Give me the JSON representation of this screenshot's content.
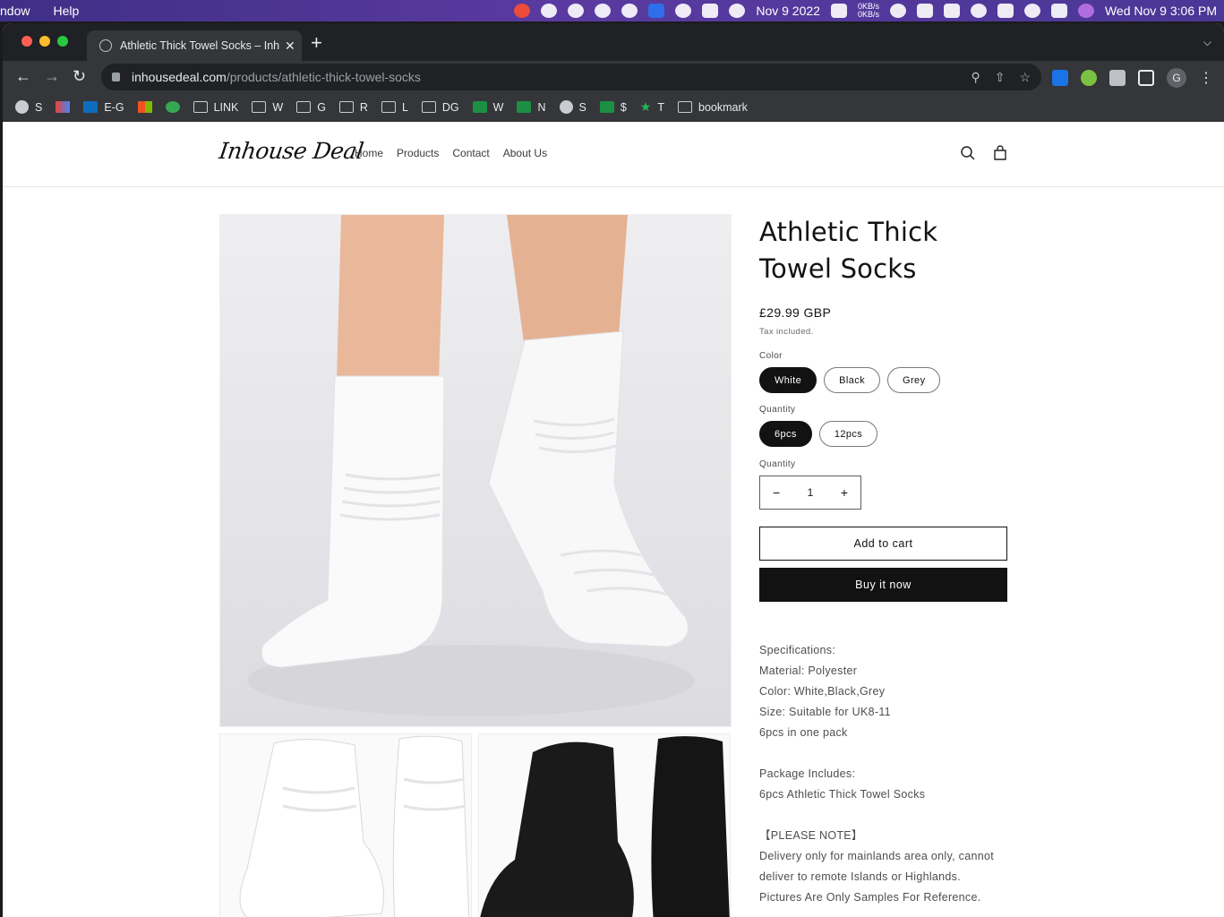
{
  "menubar": {
    "app_partial": "ndow",
    "help": "Help",
    "date": "Nov 9 2022",
    "net_up": "0KB/s",
    "net_down": "0KB/s",
    "clock": "Wed Nov 9  3:06 PM"
  },
  "browser": {
    "tab_title": "Athletic Thick Towel Socks – Inhouse Deal",
    "tab_close": "✕",
    "new_tab": "+",
    "url_host": "inhousedeal.com",
    "url_path": "/products/athletic-thick-towel-socks",
    "profile_initial": "G"
  },
  "bookmarks": [
    {
      "label": "S",
      "icon": "globe"
    },
    {
      "label": "",
      "icon": "gmail"
    },
    {
      "label": "E-G",
      "icon": "outlook"
    },
    {
      "label": "",
      "icon": "microsoft"
    },
    {
      "label": "",
      "icon": "grammarly"
    },
    {
      "label": "LINK",
      "icon": "folder"
    },
    {
      "label": "W",
      "icon": "folder"
    },
    {
      "label": "G",
      "icon": "folder"
    },
    {
      "label": "R",
      "icon": "folder"
    },
    {
      "label": "L",
      "icon": "folder"
    },
    {
      "label": "DG",
      "icon": "folder"
    },
    {
      "label": "W",
      "icon": "sheet"
    },
    {
      "label": "N",
      "icon": "sheet"
    },
    {
      "label": "S",
      "icon": "globe"
    },
    {
      "label": "$",
      "icon": "sheet"
    },
    {
      "label": "T",
      "icon": "star"
    },
    {
      "label": "bookmark",
      "icon": "folder"
    }
  ],
  "site": {
    "logo": "Inhouse Deal",
    "nav": [
      "Home",
      "Products",
      "Contact",
      "About Us"
    ]
  },
  "product": {
    "title": "Athletic Thick Towel Socks",
    "price": "£29.99 GBP",
    "tax": "Tax included.",
    "color_label": "Color",
    "colors": [
      "White",
      "Black",
      "Grey"
    ],
    "selected_color": "White",
    "pack_label": "Quantity",
    "packs": [
      "6pcs",
      "12pcs"
    ],
    "selected_pack": "6pcs",
    "qty_label": "Quantity",
    "qty_minus": "−",
    "qty_value": "1",
    "qty_plus": "+",
    "add_to_cart": "Add to cart",
    "buy_now": "Buy it now",
    "description": {
      "specs_header": "Specifications:",
      "material": "Material: Polyester",
      "color": "Color: White,Black,Grey",
      "size": "Size: Suitable for UK8-11",
      "pack": "6pcs in one pack",
      "package_header": "Package Includes:",
      "package_item": "6pcs Athletic Thick Towel Socks",
      "note_header": "【PLEASE NOTE】",
      "note_1": "Delivery only for mainlands area only, cannot",
      "note_2": "deliver to remote Islands or Highlands.",
      "note_3": "Pictures Are Only Samples For Reference."
    }
  }
}
